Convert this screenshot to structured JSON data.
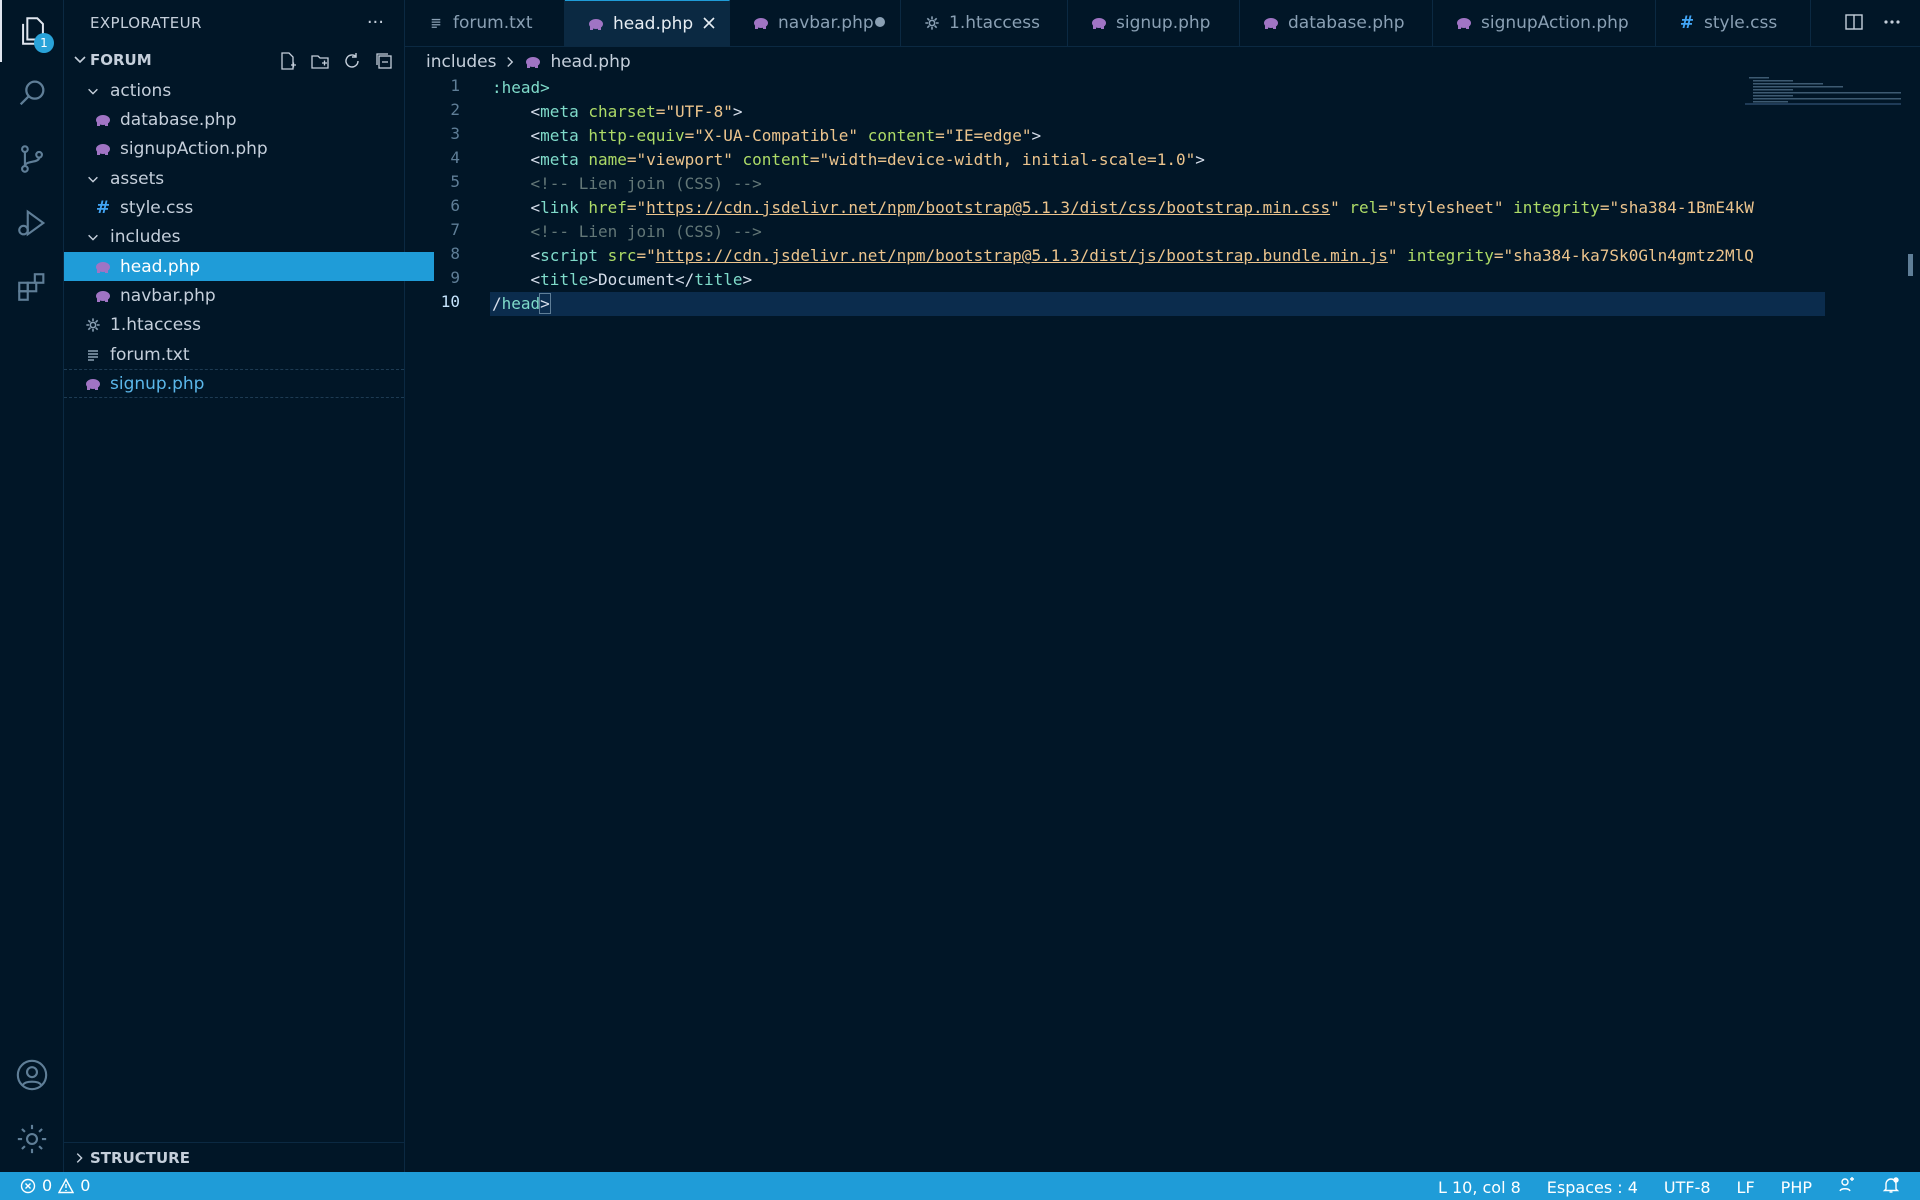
{
  "activity": {
    "explorer_badge": "1"
  },
  "sidebar": {
    "title": "EXPLORATEUR",
    "more": "···",
    "folder": "FORUM",
    "structure": "STRUCTURE",
    "tree": [
      {
        "label": "actions",
        "kind": "folder"
      },
      {
        "label": "database.php",
        "kind": "php"
      },
      {
        "label": "signupAction.php",
        "kind": "php"
      },
      {
        "label": "assets",
        "kind": "folder"
      },
      {
        "label": "style.css",
        "kind": "css"
      },
      {
        "label": "includes",
        "kind": "folder"
      },
      {
        "label": "head.php",
        "kind": "php"
      },
      {
        "label": "navbar.php",
        "kind": "php"
      },
      {
        "label": "1.htaccess",
        "kind": "gear"
      },
      {
        "label": "forum.txt",
        "kind": "txt"
      },
      {
        "label": "signup.php",
        "kind": "php"
      }
    ]
  },
  "tabs": [
    {
      "label": "forum.txt",
      "kind": "txt"
    },
    {
      "label": "head.php",
      "kind": "php",
      "active": true
    },
    {
      "label": "navbar.php",
      "kind": "php",
      "dirty": true
    },
    {
      "label": "1.htaccess",
      "kind": "gear"
    },
    {
      "label": "signup.php",
      "kind": "php"
    },
    {
      "label": "database.php",
      "kind": "php"
    },
    {
      "label": "signupAction.php",
      "kind": "php"
    },
    {
      "label": "style.css",
      "kind": "css"
    }
  ],
  "breadcrumb": {
    "folder": "includes",
    "file": "head.php"
  },
  "editor": {
    "line_numbers": [
      "1",
      "2",
      "3",
      "4",
      "5",
      "6",
      "7",
      "8",
      "9",
      "10"
    ],
    "lines": {
      "l1": ":head>",
      "l2a": "    <",
      "l2b": "meta",
      "l2c": " charset",
      "l2d": "=\"UTF-8\"",
      "l2e": ">",
      "l3a": "    <",
      "l3b": "meta",
      "l3c": " http-equiv",
      "l3d": "=\"X-UA-Compatible\"",
      "l3e": " content",
      "l3f": "=\"IE=edge\"",
      "l3g": ">",
      "l4a": "    <",
      "l4b": "meta",
      "l4c": " name",
      "l4d": "=\"viewport\"",
      "l4e": " content",
      "l4f": "=\"width=device-width, initial-scale=1.0\"",
      "l4g": ">",
      "l5": "    <!-- Lien join (CSS) -->",
      "l6a": "    <",
      "l6b": "link",
      "l6c": " href",
      "l6d": "=\"",
      "l6e": "https://cdn.jsdelivr.net/npm/bootstrap@5.1.3/dist/css/bootstrap.min.css",
      "l6f": "\"",
      "l6g": " rel",
      "l6h": "=\"stylesheet\"",
      "l6i": " integrity",
      "l6j": "=\"sha384-1BmE4kW",
      "l7": "    <!-- Lien join (CSS) -->",
      "l8a": "    <",
      "l8b": "script",
      "l8c": " src",
      "l8d": "=\"",
      "l8e": "https://cdn.jsdelivr.net/npm/bootstrap@5.1.3/dist/js/bootstrap.bundle.min.js",
      "l8f": "\"",
      "l8g": " integrity",
      "l8h": "=\"sha384-ka7Sk0Gln4gmtz2MlQ",
      "l9a": "    <",
      "l9b": "title",
      "l9c": ">Document</",
      "l9d": "title",
      "l9e": ">",
      "l10a": "/",
      "l10b": "head",
      "l10c": ">"
    }
  },
  "status": {
    "errors": "0",
    "warnings": "0",
    "position": "L 10, col 8",
    "spaces": "Espaces : 4",
    "encoding": "UTF-8",
    "eol": "LF",
    "language": "PHP"
  },
  "colors": {
    "accent": "#1f9cd8",
    "background": "#011627",
    "php_icon": "#a074c4"
  }
}
